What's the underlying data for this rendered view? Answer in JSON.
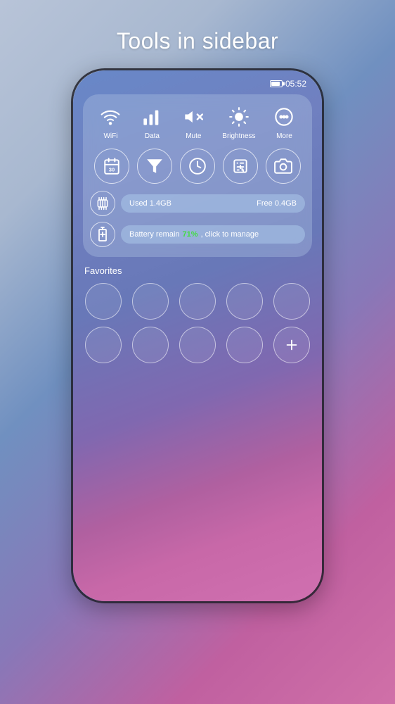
{
  "page": {
    "title": "Tools in sidebar"
  },
  "statusBar": {
    "time": "05:52"
  },
  "quickToggles": [
    {
      "id": "wifi",
      "label": "WiFi",
      "icon": "wifi"
    },
    {
      "id": "data",
      "label": "Data",
      "icon": "data"
    },
    {
      "id": "mute",
      "label": "Mute",
      "icon": "mute"
    },
    {
      "id": "brightness",
      "label": "Brightness",
      "icon": "brightness"
    },
    {
      "id": "more",
      "label": "More",
      "icon": "more"
    }
  ],
  "appRow": [
    {
      "id": "calendar",
      "icon": "calendar",
      "label": "30"
    },
    {
      "id": "filter",
      "icon": "filter"
    },
    {
      "id": "clock",
      "icon": "clock"
    },
    {
      "id": "calculator",
      "icon": "calculator"
    },
    {
      "id": "camera",
      "icon": "camera"
    }
  ],
  "ram": {
    "used": "Used 1.4GB",
    "free": "Free 0.4GB"
  },
  "battery": {
    "prefix": "Battery remain ",
    "percent": "71%",
    "suffix": ", click to manage"
  },
  "favorites": {
    "label": "Favorites",
    "addLabel": "+"
  }
}
